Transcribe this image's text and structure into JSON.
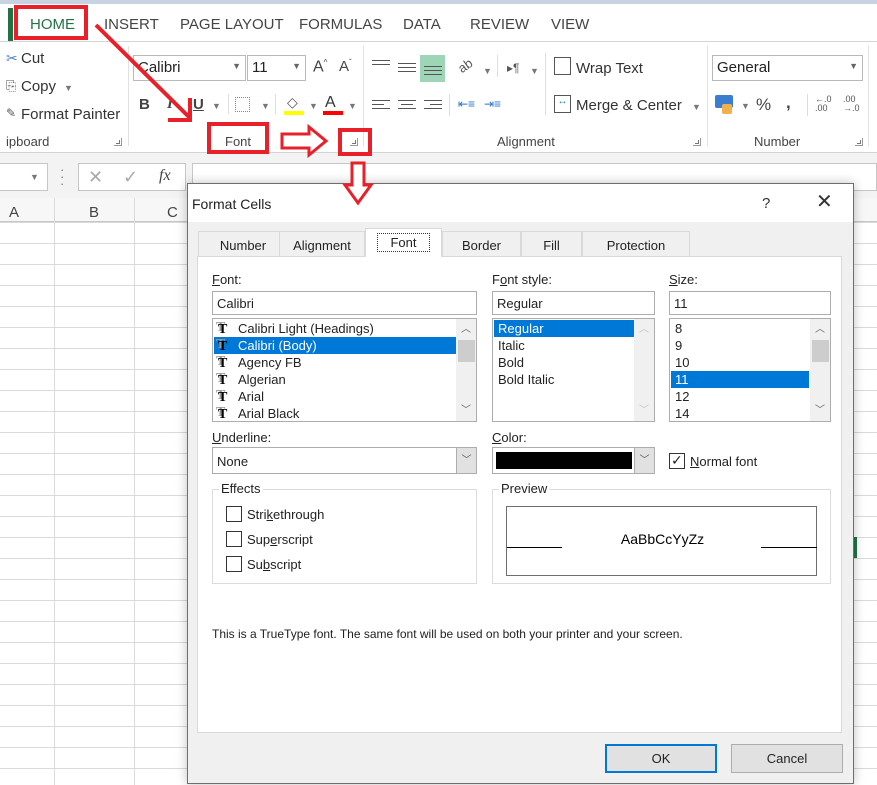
{
  "ribbon_tabs": [
    "HOME",
    "INSERT",
    "PAGE LAYOUT",
    "FORMULAS",
    "DATA",
    "REVIEW",
    "VIEW"
  ],
  "clipboard": {
    "cut": "Cut",
    "copy": "Copy",
    "format_painter": "Format Painter",
    "group_label": "ipboard"
  },
  "font_group": {
    "font_name": "Calibri",
    "font_size": "11",
    "bold": "B",
    "italic": "I",
    "underline": "U",
    "grow": "A",
    "shrink": "A",
    "font_color": "A",
    "group_label": "Font",
    "fill_color_hex": "#ffff00",
    "font_color_hex": "#ff0000"
  },
  "alignment_group": {
    "wrap_text": "Wrap Text",
    "merge_center": "Merge & Center",
    "group_label": "Alignment"
  },
  "number_group": {
    "format": "General",
    "percent": "%",
    "comma": ",",
    "inc_decimal": "←.0 .00",
    "dec_decimal": ".00 →.0",
    "group_label": "Number"
  },
  "formula_bar": {
    "cancel_icon": "✕",
    "enter_icon": "✓",
    "fx_label": "fx",
    "value": ""
  },
  "columns": [
    "A",
    "B",
    "C"
  ],
  "dialog": {
    "title": "Format Cells",
    "help": "?",
    "close": "✕",
    "tabs": [
      "Number",
      "Alignment",
      "Font",
      "Border",
      "Fill",
      "Protection"
    ],
    "active_tab": "Font",
    "font_label_u": "F",
    "font_label_rest": "ont:",
    "font_value": "Calibri",
    "font_list": [
      "Calibri Light (Headings)",
      "Calibri (Body)",
      "Agency FB",
      "Algerian",
      "Arial",
      "Arial Black"
    ],
    "font_selected_index": 1,
    "style_label_pre": "F",
    "style_label_u": "o",
    "style_label_rest": "nt style:",
    "style_value": "Regular",
    "style_list": [
      "Regular",
      "Italic",
      "Bold",
      "Bold Italic"
    ],
    "style_selected_index": 0,
    "size_label_u": "S",
    "size_label_rest": "ize:",
    "size_value": "11",
    "size_list": [
      "8",
      "9",
      "10",
      "11",
      "12",
      "14"
    ],
    "size_selected_index": 3,
    "underline_label_u": "U",
    "underline_label_rest": "nderline:",
    "underline_value": "None",
    "color_label_u": "C",
    "color_label_rest": "olor:",
    "color_value_hex": "#000000",
    "normal_font_u": "N",
    "normal_font_rest": "ormal font",
    "normal_font_checked": true,
    "effects_title": "Effects",
    "effects": [
      {
        "pre": "Stri",
        "u": "k",
        "rest": "ethrough",
        "checked": false
      },
      {
        "pre": "Sup",
        "u": "e",
        "rest": "rscript",
        "checked": false
      },
      {
        "pre": "Su",
        "u": "b",
        "rest": "script",
        "checked": false
      }
    ],
    "preview_title": "Preview",
    "preview_text": "AaBbCcYyZz",
    "info_text": "This is a TrueType font.  The same font will be used on both your printer and your screen.",
    "ok": "OK",
    "cancel": "Cancel"
  },
  "annotation_color": "#e8202a"
}
